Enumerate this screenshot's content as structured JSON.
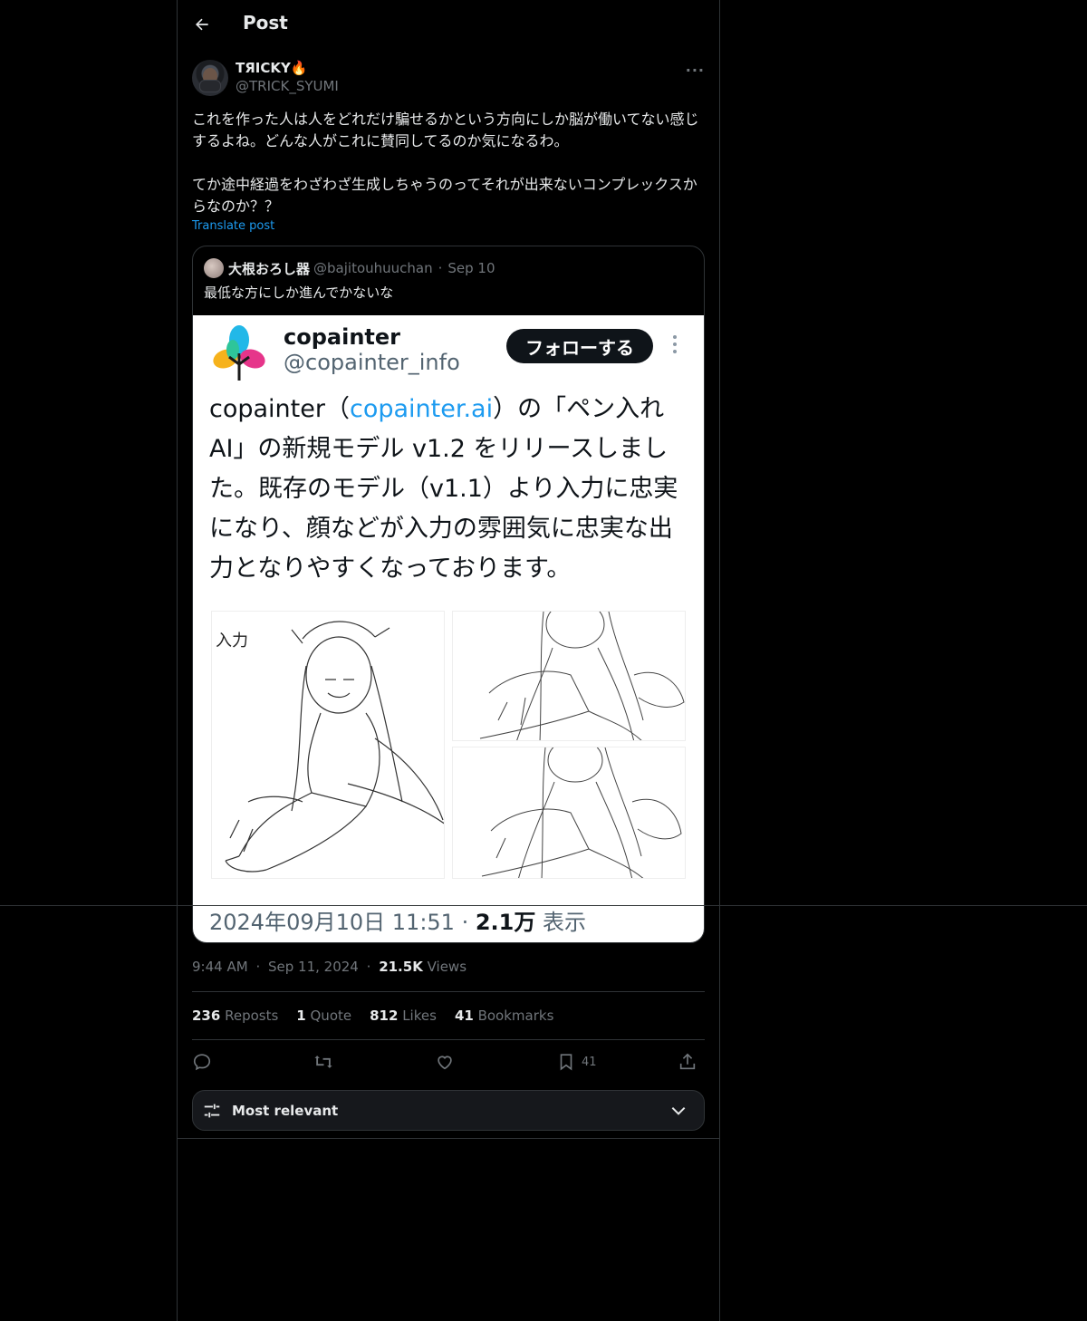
{
  "header": {
    "title": "Post"
  },
  "author": {
    "name": "TЯICKY🔥",
    "handle": "@TRICK_SYUMI"
  },
  "post": {
    "text": "これを作った人は人をどれだけ騙せるかという方向にしか脳が働いてない感じするよね。どんな人がこれに賛同してるのか気になるわ。\n\nてか途中経過をわざわざ生成しちゃうのってそれが出来ないコンプレックスからなのか？？",
    "translate_label": "Translate post"
  },
  "quote": {
    "name": "大根おろし器",
    "handle": "@bajitouhuuchan",
    "separator": "·",
    "date": "Sep 10",
    "text": "最低な方にしか進んでかないな",
    "screenshot": {
      "name": "copainter",
      "handle": "@copainter_info",
      "follow_label": "フォローする",
      "text_before": "copainter（",
      "link": "copainter.ai",
      "text_after": "）の「ペン入れAI」の新規モデル v1.2 をリリースしました。既存のモデル（v1.1）より入力に忠実になり、顔などが入力の雰囲気に忠実な出力となりやすくなっております。",
      "input_label": "入力",
      "meta_time": "2024年09月10日 11:51",
      "meta_sep": " · ",
      "meta_views": "2.1万",
      "meta_views_label": " 表示"
    }
  },
  "meta": {
    "time": "9:44 AM",
    "sep": "·",
    "date": "Sep 11, 2024",
    "views": "21.5K",
    "views_label": "Views"
  },
  "stats": {
    "reposts": "236",
    "reposts_label": "Reposts",
    "quotes": "1",
    "quotes_label": "Quote",
    "likes": "812",
    "likes_label": "Likes",
    "bookmarks": "41",
    "bookmarks_label": "Bookmarks"
  },
  "actions": {
    "bookmark_count": "41"
  },
  "sort": {
    "label": "Most relevant"
  },
  "icons": [
    "back-arrow-icon",
    "more-icon",
    "reply-icon",
    "repost-icon",
    "like-icon",
    "bookmark-icon",
    "share-icon",
    "sliders-icon",
    "chevron-down-icon"
  ],
  "colors": {
    "background": "#000000",
    "text": "#e7e9ea",
    "secondary": "#71767b",
    "link": "#1d9bf0",
    "border": "#2f3336"
  }
}
